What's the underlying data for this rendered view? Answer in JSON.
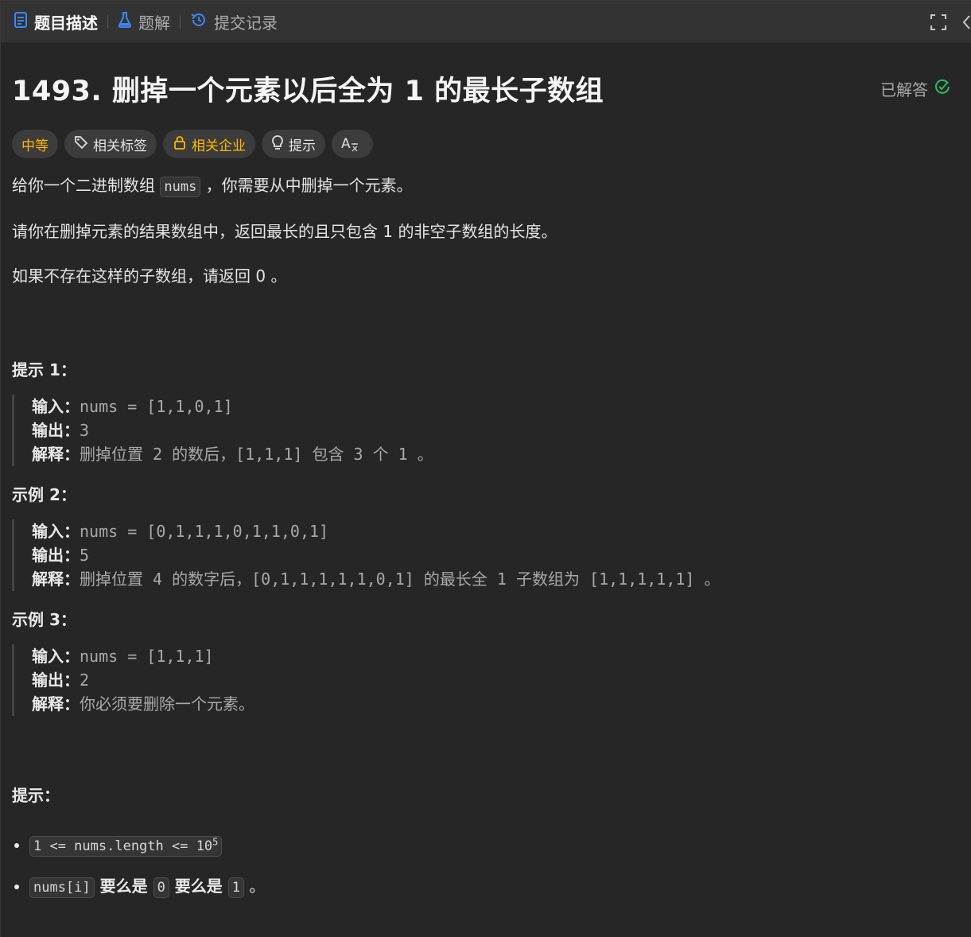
{
  "tabs": [
    {
      "label": "题目描述",
      "active": true
    },
    {
      "label": "题解",
      "active": false
    },
    {
      "label": "提交记录",
      "active": false
    }
  ],
  "problem": {
    "title": "1493. 删掉一个元素以后全为 1 的最长子数组",
    "status": "已解答"
  },
  "tags": {
    "difficulty": "中等",
    "related_tags": "相关标签",
    "related_companies": "相关企业",
    "hint": "提示",
    "translate_icon_text": "A"
  },
  "description": {
    "p1_before": "给你一个二进制数组 ",
    "p1_code": "nums",
    "p1_after": " ，你需要从中删掉一个元素。",
    "p2": "请你在删掉元素的结果数组中，返回最长的且只包含 1 的非空子数组的长度。",
    "p3": "如果不存在这样的子数组，请返回 0 。"
  },
  "examples": [
    {
      "heading": "提示 1：",
      "input_label": "输入：",
      "input": "nums = [1,1,0,1]",
      "output_label": "输出：",
      "output": "3",
      "explain_label": "解释：",
      "explain": "删掉位置 2 的数后，[1,1,1] 包含 3 个 1 。"
    },
    {
      "heading": "示例 2：",
      "input_label": "输入：",
      "input": "nums = [0,1,1,1,0,1,1,0,1]",
      "output_label": "输出：",
      "output": "5",
      "explain_label": "解释：",
      "explain": "删掉位置 4 的数字后，[0,1,1,1,1,1,0,1] 的最长全 1 子数组为 [1,1,1,1,1] 。"
    },
    {
      "heading": "示例 3：",
      "input_label": "输入：",
      "input": "nums = [1,1,1]",
      "output_label": "输出：",
      "output": "2",
      "explain_label": "解释：",
      "explain": "你必须要删除一个元素。"
    }
  ],
  "constraints": {
    "heading": "提示：",
    "c1_code": "1 <= nums.length <= 10",
    "c1_sup": "5",
    "c2_code_a": "nums[i]",
    "c2_text_a": " 要么是 ",
    "c2_code_b": "0",
    "c2_text_b": " 要么是 ",
    "c2_code_c": "1",
    "c2_text_c": " 。"
  },
  "colors": {
    "accent_blue": "#3c87f7",
    "difficulty_medium": "#ffb800",
    "solved_green": "#2cbb5d",
    "background": "#262626",
    "tabbar": "#333333"
  },
  "icons": {
    "tab_description": "document-icon",
    "tab_solutions": "flask-icon",
    "tab_submissions": "history-icon",
    "expand": "fullscreen-icon",
    "solved": "check-circle-icon",
    "tag": "tag-icon",
    "company": "lock-icon",
    "hint": "lightbulb-icon",
    "translate": "translate-icon"
  }
}
